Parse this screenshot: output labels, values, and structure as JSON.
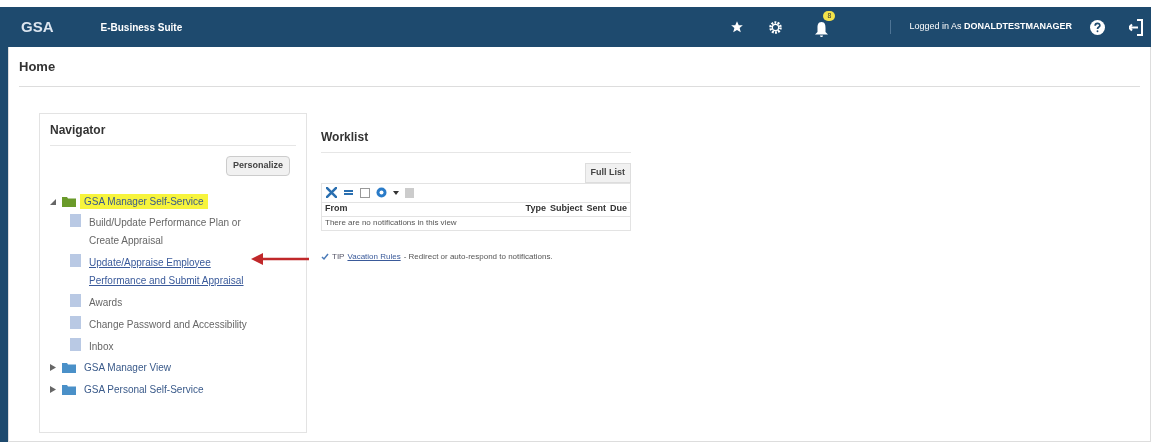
{
  "header": {
    "logo": "GSA",
    "app_title": "E-Business Suite",
    "notification_count": "8",
    "logged_in_label": "Logged in As",
    "user": "DONALDTESTMANAGER"
  },
  "page_title": "Home",
  "navigator": {
    "title": "Navigator",
    "personalize_button": "Personalize",
    "tree": [
      {
        "kind": "folder",
        "label": "GSA Manager Self-Service",
        "expanded": true,
        "highlighted": true,
        "children": [
          {
            "kind": "page",
            "label": "Build/Update Performance Plan or Create Appraisal",
            "link": false
          },
          {
            "kind": "page",
            "label": "Update/Appraise Employee Performance and Submit Appraisal",
            "link": true
          },
          {
            "kind": "page",
            "label": "Awards",
            "link": false
          },
          {
            "kind": "page",
            "label": "Change Password and Accessibility",
            "link": false
          },
          {
            "kind": "page",
            "label": "Inbox",
            "link": false
          }
        ]
      },
      {
        "kind": "folder",
        "label": "GSA Manager View",
        "expanded": false,
        "highlighted": false
      },
      {
        "kind": "folder",
        "label": "GSA Personal Self-Service",
        "expanded": false,
        "highlighted": false
      }
    ]
  },
  "worklist": {
    "title": "Worklist",
    "full_list_button": "Full List",
    "columns": [
      "From",
      "Type",
      "Subject",
      "Sent",
      "Due"
    ],
    "empty_message": "There are no notifications in this view",
    "tip_label": "TIP",
    "tip_link": "Vacation Rules",
    "tip_text": "- Redirect or auto-respond to notifications."
  }
}
